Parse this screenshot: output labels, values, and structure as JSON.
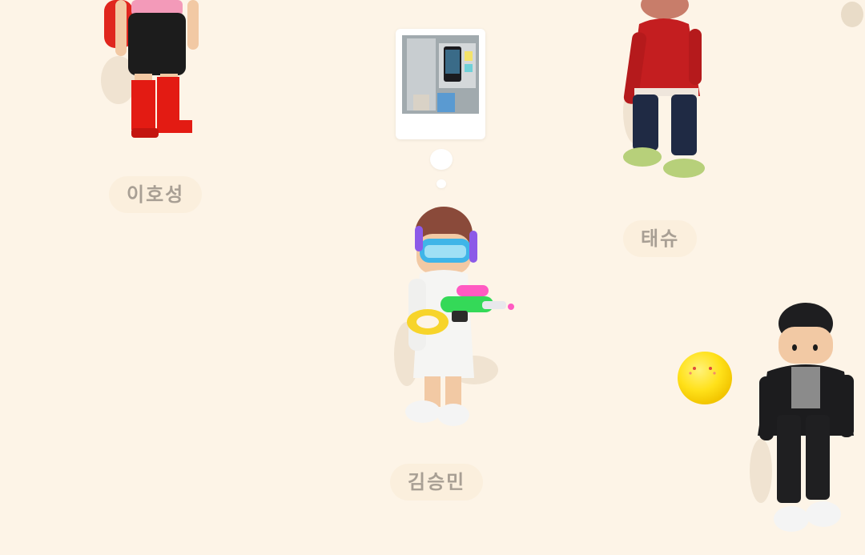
{
  "players": [
    {
      "name": "이호성"
    },
    {
      "name": "태슈"
    },
    {
      "name": "김승민"
    }
  ],
  "colors": {
    "background": "#fdf4e7",
    "name_tag_bg": "#fbefdd",
    "name_tag_text": "#a89f94",
    "emoji_yellow": "#ffe11a"
  }
}
